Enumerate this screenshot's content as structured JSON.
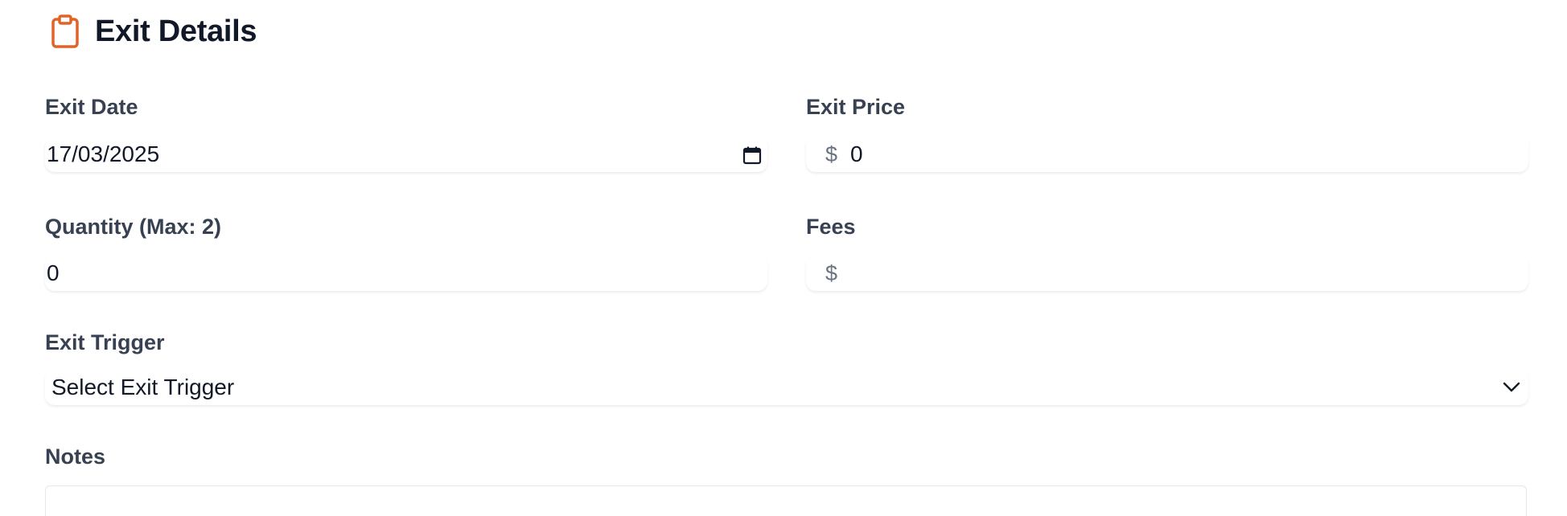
{
  "header": {
    "title": "Exit Details",
    "icon": "clipboard-icon",
    "icon_color": "#e0642a"
  },
  "form": {
    "exit_date": {
      "label": "Exit Date",
      "value": "17/03/2025",
      "icon": "calendar-icon"
    },
    "exit_price": {
      "label": "Exit Price",
      "prefix": "$",
      "value": "0"
    },
    "quantity": {
      "label": "Quantity (Max: 2)",
      "value": "0"
    },
    "fees": {
      "label": "Fees",
      "prefix": "$",
      "value": ""
    },
    "exit_trigger": {
      "label": "Exit Trigger",
      "value": "Select Exit Trigger",
      "icon": "chevron-down-icon"
    },
    "notes": {
      "label": "Notes",
      "value": ""
    }
  }
}
